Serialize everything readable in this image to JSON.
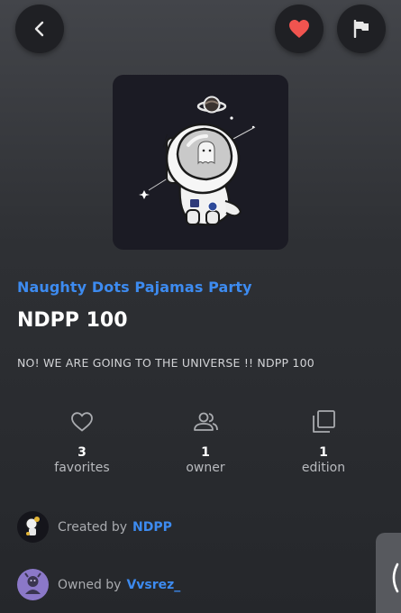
{
  "header": {
    "back_icon": "chevron-left-icon",
    "favorite_icon": "heart-icon",
    "favorite_color": "#f0544f",
    "report_icon": "flag-icon"
  },
  "nft": {
    "collection": "Naughty Dots Pajamas Party",
    "title": "NDPP 100",
    "description": "NO! WE ARE GOING TO THE UNIVERSE !! NDPP 100",
    "image_alt": "astronaut-artwork"
  },
  "stats": {
    "favorites": {
      "value": "3",
      "label": "favorites",
      "icon": "heart-outline-icon"
    },
    "owner": {
      "value": "1",
      "label": "owner",
      "icon": "people-icon"
    },
    "edition": {
      "value": "1",
      "label": "edition",
      "icon": "copies-icon"
    }
  },
  "creator": {
    "prefix": "Created by",
    "name": "NDPP"
  },
  "owner": {
    "prefix": "Owned by",
    "name": "Vvsrez_"
  },
  "side_tab": {
    "icon": "chevron-left-icon"
  },
  "colors": {
    "accent": "#3d8bf0",
    "background": "#2e3034"
  }
}
